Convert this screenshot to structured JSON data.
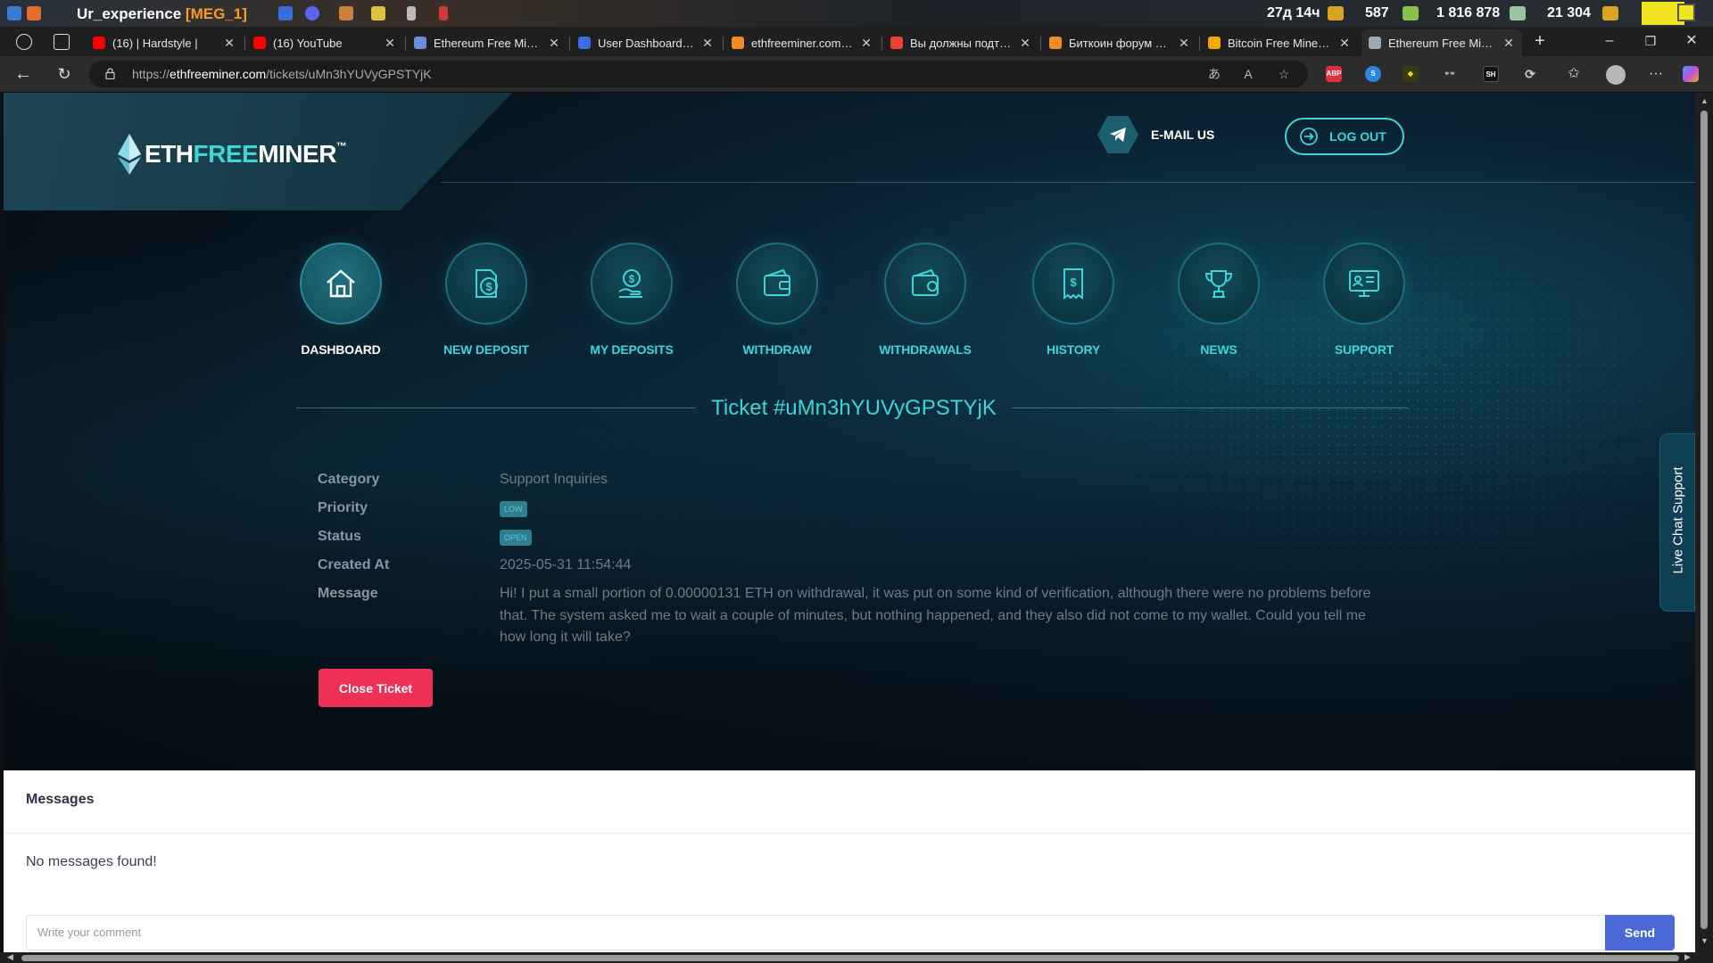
{
  "os_bar": {
    "game_title": "Ur_experience",
    "game_tag": "[MEG_1]",
    "stats": [
      "27д 14ч",
      "587",
      "1 816 878",
      "21 304"
    ]
  },
  "tabs": [
    {
      "title": "(16) | Hardstyle |",
      "favicon_color": "#ff0000"
    },
    {
      "title": "(16) YouTube",
      "favicon_color": "#ff0000"
    },
    {
      "title": "Ethereum Free Miner",
      "favicon_color": "#6c8bd8"
    },
    {
      "title": "User Dashboard | Fauc",
      "favicon_color": "#3f6be3"
    },
    {
      "title": "ethfreeminer.com-Ho",
      "favicon_color": "#f08a24"
    },
    {
      "title": "Вы должны подтверд",
      "favicon_color": "#ea4335"
    },
    {
      "title": "Биткоин форум - Бит",
      "favicon_color": "#f08a24"
    },
    {
      "title": "Bitcoin Free Miner - A",
      "favicon_color": "#f2a900"
    },
    {
      "title": "Ethereum Free Miner",
      "favicon_color": "#9aa7b5"
    }
  ],
  "address_bar": {
    "url_prefix": "https://",
    "url_domain": "ethfreeminer.com",
    "url_path": "/tickets/uMn3hYUVyGPSTYjK",
    "extensions": [
      "ABP",
      "S",
      "◆",
      "👓",
      "SH",
      "⟳"
    ]
  },
  "header": {
    "logo_eth": "ETH",
    "logo_free": "FREE",
    "logo_miner": "MINER",
    "logo_tm": "™",
    "email_label": "E-MAIL US",
    "logout_label": "LOG OUT"
  },
  "nav": {
    "items": [
      {
        "label": "DASHBOARD",
        "icon": "home-icon"
      },
      {
        "label": "NEW DEPOSIT",
        "icon": "deposit-icon"
      },
      {
        "label": "MY DEPOSITS",
        "icon": "hand-coin-icon"
      },
      {
        "label": "WITHDRAW",
        "icon": "wallet-icon"
      },
      {
        "label": "WITHDRAWALS",
        "icon": "wallet-list-icon"
      },
      {
        "label": "HISTORY",
        "icon": "receipt-icon"
      },
      {
        "label": "NEWS",
        "icon": "trophy-icon"
      },
      {
        "label": "SUPPORT",
        "icon": "monitor-chat-icon"
      }
    ]
  },
  "ticket": {
    "title": "Ticket #uMn3hYUVyGPSTYjK",
    "category_label": "Category",
    "category_value": "Support Inquiries",
    "priority_label": "Priority",
    "priority_value": "LOW",
    "status_label": "Status",
    "status_value": "OPEN",
    "created_label": "Created At",
    "created_value": "2025-05-31 11:54:44",
    "message_label": "Message",
    "message_value": "Hi! I put a small portion of 0.00000131 ETH on withdrawal, it was put on some kind of verification, although there were no problems before that. The system asked me to wait a couple of minutes, but nothing happened, and they also did not come to my wallet. Could you tell me how long it will take?",
    "close_button": "Close Ticket"
  },
  "live_chat": {
    "label": "Live Chat Support"
  },
  "messages": {
    "heading": "Messages",
    "empty_text": "No messages found!",
    "input_placeholder": "Write your comment",
    "send_label": "Send"
  },
  "colors": {
    "accent": "#3fd5d8",
    "close_button": "#ee3057",
    "send_button": "#4a68d6"
  }
}
